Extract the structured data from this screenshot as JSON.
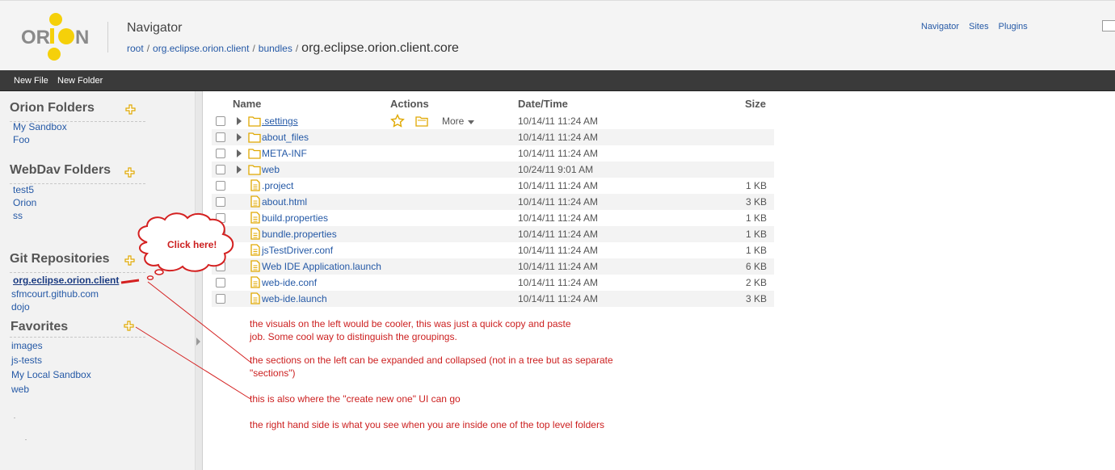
{
  "header": {
    "logo_text": "ORION",
    "title": "Navigator",
    "breadcrumb": [
      "root",
      "org.eclipse.orion.client",
      "bundles"
    ],
    "breadcrumb_separator": "/",
    "current_folder": "org.eclipse.orion.client.core",
    "links": [
      "Navigator",
      "Sites",
      "Plugins"
    ]
  },
  "toolbar": {
    "new_file": "New File",
    "new_folder": "New Folder"
  },
  "sidebar": {
    "sections": [
      {
        "title": "Orion Folders",
        "items": [
          "My Sandbox",
          "Foo"
        ]
      },
      {
        "title": "WebDav Folders",
        "items": [
          "test5",
          "Orion",
          "ss"
        ]
      },
      {
        "title": "Git Repositories",
        "items": [
          "org.eclipse.orion.client",
          "sfmcourt.github.com",
          "dojo"
        ]
      },
      {
        "title": "Favorites",
        "items": [
          "images",
          "js-tests",
          "My Local Sandbox",
          "web"
        ]
      }
    ]
  },
  "table": {
    "headers": {
      "name": "Name",
      "actions": "Actions",
      "date": "Date/Time",
      "size": "Size"
    },
    "more_label": "More",
    "rows": [
      {
        "name": ".settings",
        "type": "folder",
        "date": "10/14/11 11:24 AM",
        "size": ""
      },
      {
        "name": "about_files",
        "type": "folder",
        "date": "10/14/11 11:24 AM",
        "size": ""
      },
      {
        "name": "META-INF",
        "type": "folder",
        "date": "10/14/11 11:24 AM",
        "size": ""
      },
      {
        "name": "web",
        "type": "folder",
        "date": "10/24/11 9:01 AM",
        "size": ""
      },
      {
        "name": ".project",
        "type": "file",
        "date": "10/14/11 11:24 AM",
        "size": "1 KB"
      },
      {
        "name": "about.html",
        "type": "file",
        "date": "10/14/11 11:24 AM",
        "size": "3 KB"
      },
      {
        "name": "build.properties",
        "type": "file",
        "date": "10/14/11 11:24 AM",
        "size": "1 KB"
      },
      {
        "name": "bundle.properties",
        "type": "file",
        "date": "10/14/11 11:24 AM",
        "size": "1 KB"
      },
      {
        "name": "jsTestDriver.conf",
        "type": "file",
        "date": "10/14/11 11:24 AM",
        "size": "1 KB"
      },
      {
        "name": "Web IDE Application.launch",
        "type": "file",
        "date": "10/14/11 11:24 AM",
        "size": "6 KB"
      },
      {
        "name": "web-ide.conf",
        "type": "file",
        "date": "10/14/11 11:24 AM",
        "size": "2 KB"
      },
      {
        "name": "web-ide.launch",
        "type": "file",
        "date": "10/14/11 11:24 AM",
        "size": "3 KB"
      }
    ]
  },
  "annotations": {
    "bubble": "Click here!",
    "note1_line1": "the visuals on the left would be cooler, this was just a quick copy and paste",
    "note1_line2": "job.  Some cool way to distinguish the groupings.",
    "note2_line1": "the sections on the left can be expanded and collapsed (not in a tree but as separate",
    "note2_line2": "\"sections\")",
    "note3": "this is also where the \"create new one\" UI can go",
    "note4": "the right hand side is what you see when you are inside one of the top level folders"
  },
  "colors": {
    "link": "#2559a6",
    "annotation": "#cc1f1f",
    "toolbar_bg": "#3a3a3a",
    "folder_icon": "#e8b500",
    "logo_yellow": "#f5d00a"
  }
}
